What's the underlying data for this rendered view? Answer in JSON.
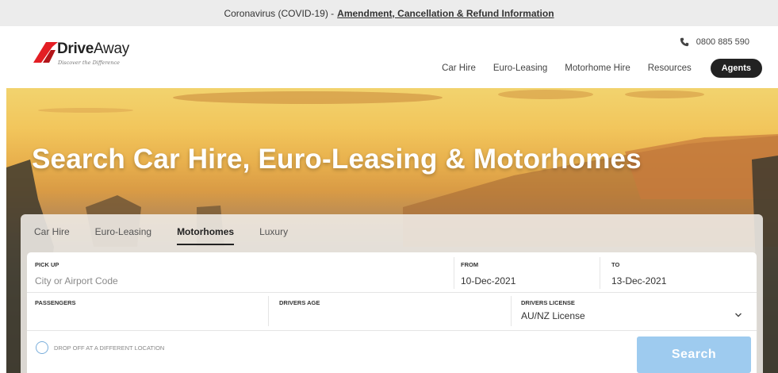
{
  "banner": {
    "text": "Coronavirus (COVID-19) -",
    "link": "Amendment, Cancellation & Refund Information"
  },
  "brand": {
    "name_bold": "Drive",
    "name_regular": "Away",
    "tagline": "Discover the Difference",
    "color": "#e31e24"
  },
  "header": {
    "phone": "0800 885 590",
    "nav": [
      "Car Hire",
      "Euro-Leasing",
      "Motorhome Hire",
      "Resources"
    ],
    "agents_label": "Agents"
  },
  "hero": {
    "title": "Search Car Hire, Euro-Leasing & Motorhomes"
  },
  "search": {
    "tabs": [
      "Car Hire",
      "Euro-Leasing",
      "Motorhomes",
      "Luxury"
    ],
    "active_tab": "Motorhomes",
    "pickup": {
      "label": "PICK UP",
      "placeholder": "City or Airport Code"
    },
    "from": {
      "label": "FROM",
      "value": "10-Dec-2021"
    },
    "to": {
      "label": "TO",
      "value": "13-Dec-2021"
    },
    "passengers": {
      "label": "PASSENGERS",
      "value": ""
    },
    "drivers_age": {
      "label": "DRIVERS AGE",
      "value": ""
    },
    "drivers_license": {
      "label": "DRIVERS LICENSE",
      "value": "AU/NZ License"
    },
    "dropoff_label": "DROP OFF AT A DIFFERENT LOCATION",
    "search_label": "Search",
    "button_color": "#9ecbef"
  },
  "icons": [
    "phone-icon",
    "chevron-down-icon",
    "logo-mark"
  ]
}
